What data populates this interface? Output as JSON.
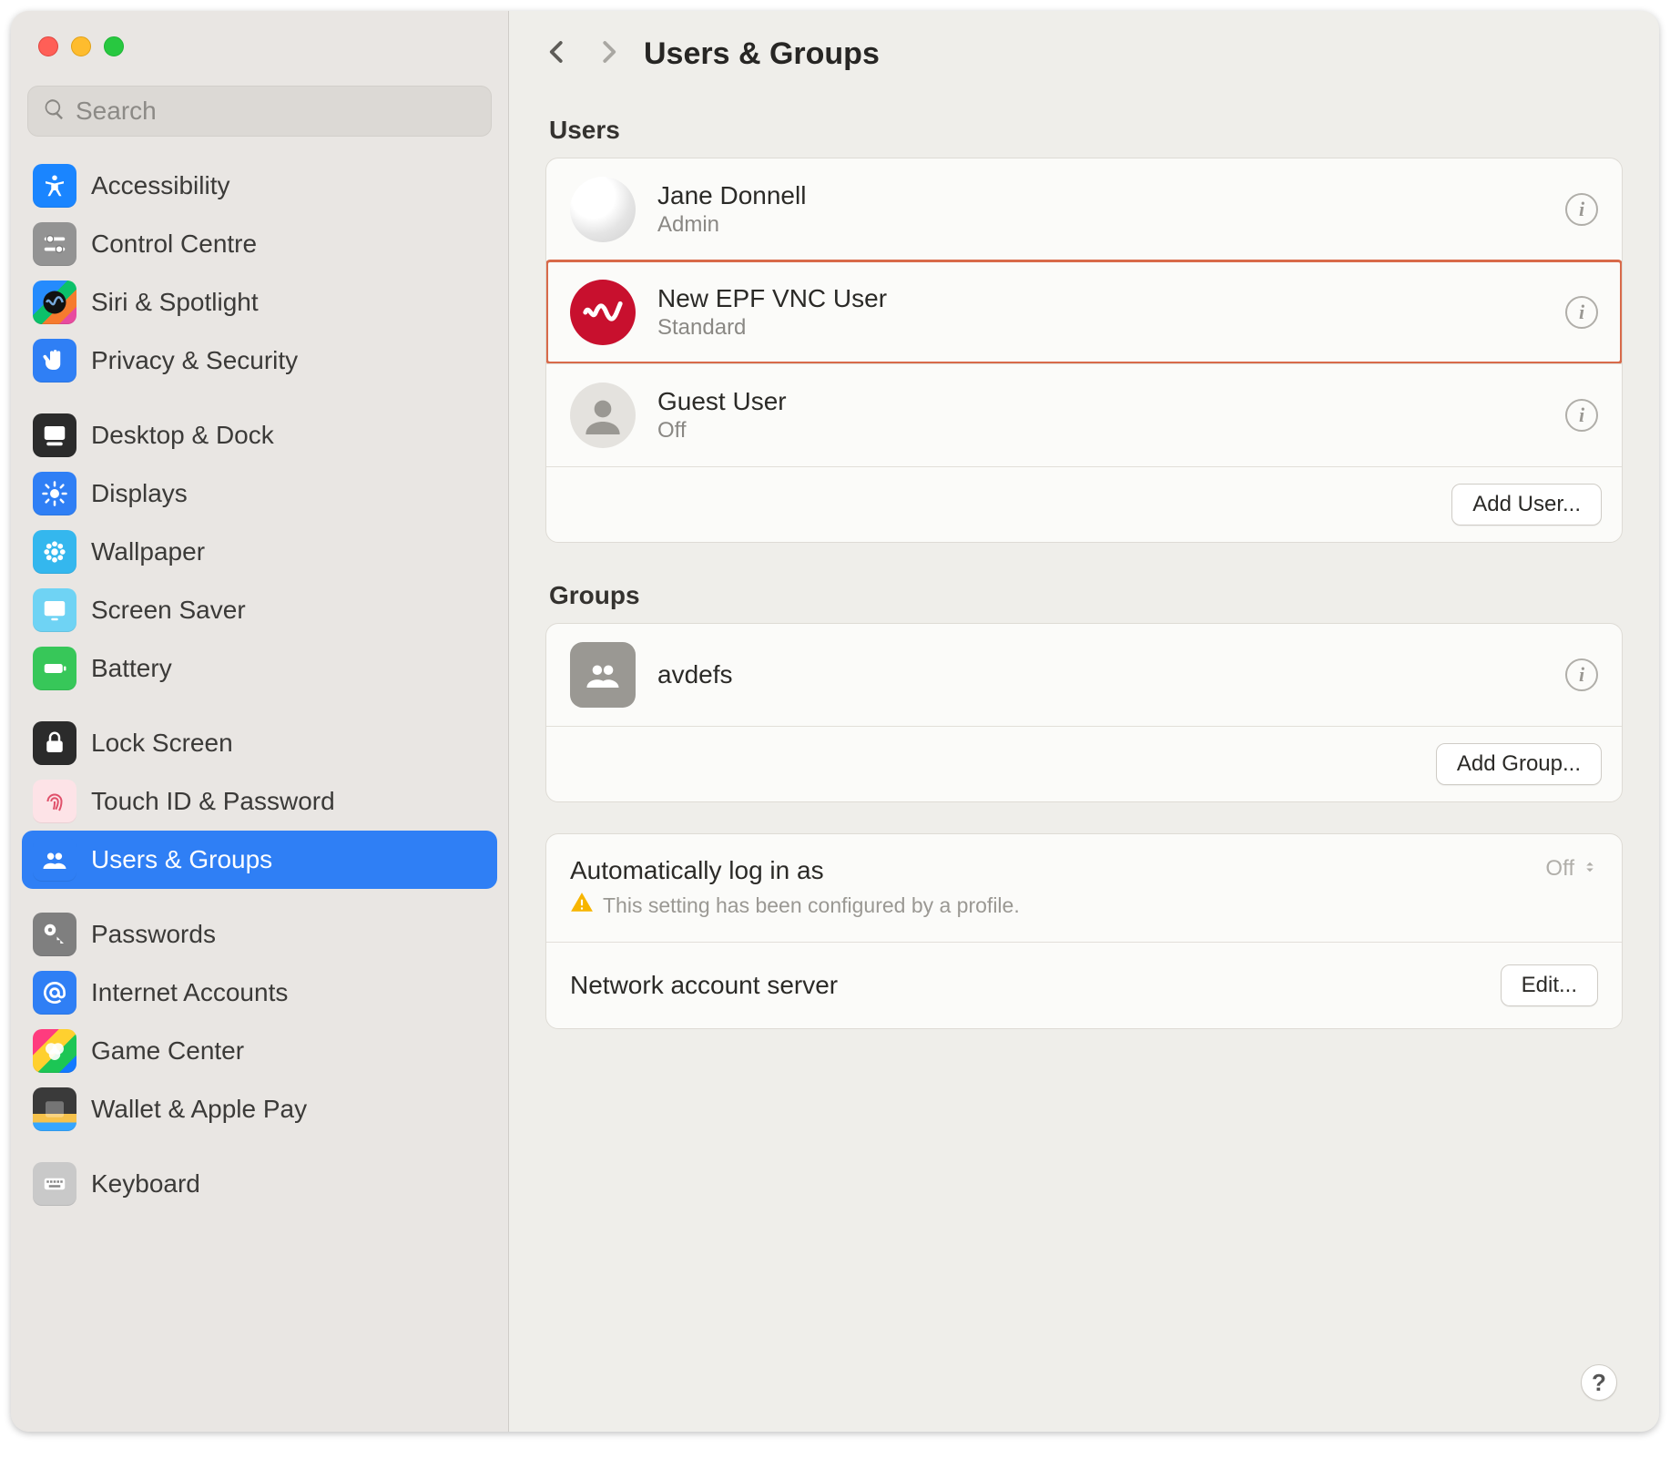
{
  "header": {
    "title": "Users & Groups"
  },
  "search": {
    "placeholder": "Search"
  },
  "sidebar": {
    "groups": [
      {
        "items": [
          {
            "label": "Accessibility",
            "icon": "accessibility-icon",
            "color": "c-blue"
          },
          {
            "label": "Control Centre",
            "icon": "sliders-icon",
            "color": "c-grey"
          },
          {
            "label": "Siri & Spotlight",
            "icon": "siri-icon",
            "color": "c-rainbow"
          },
          {
            "label": "Privacy & Security",
            "icon": "hand-icon",
            "color": "c-blue2"
          }
        ]
      },
      {
        "items": [
          {
            "label": "Desktop & Dock",
            "icon": "dock-icon",
            "color": "c-black"
          },
          {
            "label": "Displays",
            "icon": "brightness-icon",
            "color": "c-blue2"
          },
          {
            "label": "Wallpaper",
            "icon": "flower-icon",
            "color": "c-teal"
          },
          {
            "label": "Screen Saver",
            "icon": "screensaver-icon",
            "color": "c-cyan"
          },
          {
            "label": "Battery",
            "icon": "battery-icon",
            "color": "c-green"
          }
        ]
      },
      {
        "items": [
          {
            "label": "Lock Screen",
            "icon": "lock-icon",
            "color": "c-black"
          },
          {
            "label": "Touch ID & Password",
            "icon": "fingerprint-icon",
            "color": "c-pink"
          },
          {
            "label": "Users & Groups",
            "icon": "people-icon",
            "color": "c-blue2",
            "selected": true
          }
        ]
      },
      {
        "items": [
          {
            "label": "Passwords",
            "icon": "key-icon",
            "color": "c-darkgrey"
          },
          {
            "label": "Internet Accounts",
            "icon": "at-icon",
            "color": "c-blue2"
          },
          {
            "label": "Game Center",
            "icon": "gamecenter-icon",
            "color": "c-multi"
          },
          {
            "label": "Wallet & Apple Pay",
            "icon": "wallet-icon",
            "color": "c-wallet"
          }
        ]
      },
      {
        "items": [
          {
            "label": "Keyboard",
            "icon": "keyboard-icon",
            "color": "c-lightgrey"
          }
        ]
      }
    ]
  },
  "users_section": {
    "label": "Users",
    "users": [
      {
        "name": "Jane Donnell",
        "role": "Admin",
        "avatar": "golf",
        "highlighted": false
      },
      {
        "name": "New EPF VNC User",
        "role": "Standard",
        "avatar": "epf",
        "highlighted": true
      },
      {
        "name": "Guest User",
        "role": "Off",
        "avatar": "guest",
        "highlighted": false
      }
    ],
    "add_button": "Add User..."
  },
  "groups_section": {
    "label": "Groups",
    "groups": [
      {
        "name": "avdefs"
      }
    ],
    "add_button": "Add Group..."
  },
  "settings_section": {
    "auto_login": {
      "label": "Automatically log in as",
      "value": "Off",
      "note": "This setting has been configured by a profile."
    },
    "network_server": {
      "label": "Network account server",
      "button": "Edit..."
    }
  },
  "help_label": "?"
}
